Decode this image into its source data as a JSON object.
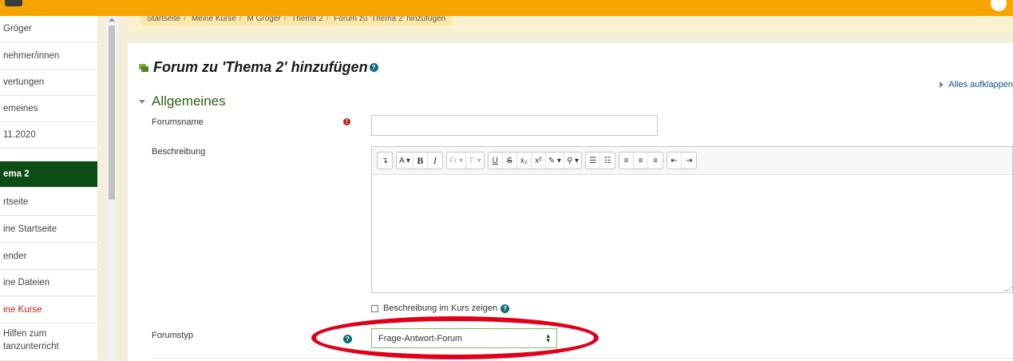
{
  "breadcrumb": [
    "Startseite",
    "Meine Kurse",
    "M Gröger",
    "Thema 2",
    "Forum zu 'Thema 2' hinzufügen"
  ],
  "sidebar": {
    "items": [
      {
        "label": "Gröger",
        "state": "normal"
      },
      {
        "label": "nehmer/innen",
        "state": "normal"
      },
      {
        "label": "vertungen",
        "state": "normal"
      },
      {
        "label": "emeines",
        "state": "normal"
      },
      {
        "label": "11.2020",
        "state": "normal"
      },
      {
        "label": "ema 2",
        "state": "active"
      },
      {
        "label": "rtseite",
        "state": "normal"
      },
      {
        "label": "ine Startseite",
        "state": "normal"
      },
      {
        "label": "ender",
        "state": "normal"
      },
      {
        "label": "ine Dateien",
        "state": "normal"
      },
      {
        "label": "ine Kurse",
        "state": "highlight"
      },
      {
        "label": "Hilfen zum",
        "label2": "tanzunterricht",
        "state": "normal"
      }
    ]
  },
  "page": {
    "title": "Forum zu 'Thema 2' hinzufügen",
    "expand_all": "Alles aufklappen",
    "section_title": "Allgemeines"
  },
  "form": {
    "forum_name_label": "Forumsname",
    "forum_name_value": "",
    "description_label": "Beschreibung",
    "description_value": "",
    "show_description_label": "Beschreibung im Kurs zeigen",
    "forum_type_label": "Forumstyp",
    "forum_type_value": "Frage-Antwort-Forum"
  },
  "editor_toolbar": [
    [
      "↴"
    ],
    [
      "A ▾",
      "B",
      "I"
    ],
    [
      "Fr ▾",
      "T: ▾"
    ],
    [
      "U",
      "S",
      "x₂",
      "x²",
      "✎ ▾",
      "⚲ ▾"
    ],
    [
      "☰",
      "☷"
    ],
    [
      "≡",
      "≡",
      "≡"
    ],
    [
      "⇤",
      "⇥"
    ]
  ],
  "colors": {
    "topbar": "#f5a400",
    "active_nav": "#0b4d14",
    "section_title": "#2d5e1a",
    "annotation": "#e0001b"
  }
}
